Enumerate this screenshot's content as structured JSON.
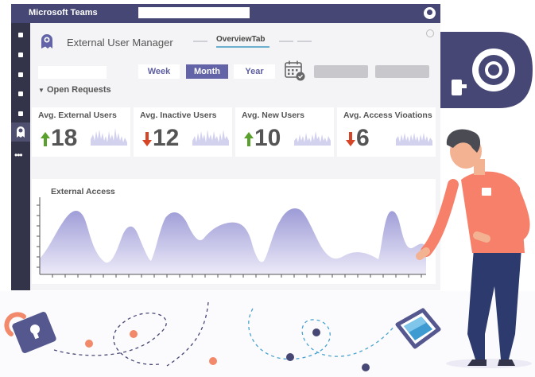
{
  "app": {
    "name": "Microsoft Teams"
  },
  "header": {
    "title": "External User Manager",
    "active_tab": "OverviewTab"
  },
  "period_toggle": {
    "options": [
      "Week",
      "Month",
      "Year"
    ],
    "selected": "Month"
  },
  "section": {
    "label": "Open Requests"
  },
  "kpis": [
    {
      "label": "Avg. External Users",
      "value": "18",
      "trend": "up"
    },
    {
      "label": "Avg. Inactive Users",
      "value": "12",
      "trend": "down"
    },
    {
      "label": "Avg. New Users",
      "value": "10",
      "trend": "up"
    },
    {
      "label": "Avg. Access Vioations",
      "value": "6",
      "trend": "down"
    }
  ],
  "chart": {
    "title": "External Access"
  },
  "colors": {
    "teams_purple": "#464775",
    "accent": "#6264a7",
    "up": "#5aa02c",
    "down": "#d64525",
    "area_fill": "#b8b6e0"
  },
  "icons": [
    "app-logo-icon",
    "calendar-icon",
    "lock-icon",
    "cube-icon",
    "eye-icon"
  ]
}
